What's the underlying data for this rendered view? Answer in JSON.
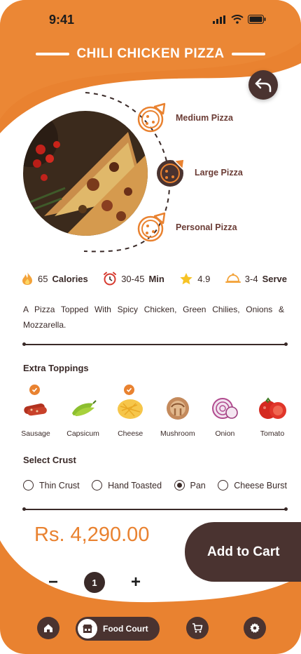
{
  "status_bar": {
    "time": "9:41"
  },
  "header": {
    "title": "CHILI CHICKEN PIZZA"
  },
  "sizes": [
    {
      "label": "Medium Pizza",
      "selected": false
    },
    {
      "label": "Large Pizza",
      "selected": true
    },
    {
      "label": "Personal Pizza",
      "selected": false
    }
  ],
  "stats": {
    "calories_value": "65",
    "calories_label": "Calories",
    "time_value": "30-45",
    "time_label": "Min",
    "rating": "4.9",
    "serve_value": "3-4",
    "serve_label": "Serve"
  },
  "description": "A Pizza Topped With Spicy Chicken, Green Chilies, Onions & Mozzarella.",
  "toppings": {
    "title": "Extra Toppings",
    "items": [
      {
        "name": "Sausage",
        "selected": true
      },
      {
        "name": "Capsicum",
        "selected": false
      },
      {
        "name": "Cheese",
        "selected": true
      },
      {
        "name": "Mushroom",
        "selected": false
      },
      {
        "name": "Onion",
        "selected": false
      },
      {
        "name": "Tomato",
        "selected": false
      }
    ]
  },
  "crust": {
    "title": "Select Crust",
    "options": [
      "Thin Crust",
      "Hand Toasted",
      "Pan",
      "Cheese Burst"
    ],
    "selected": "Pan"
  },
  "price": "Rs. 4,290.00",
  "add_to_cart_label": "Add to Cart",
  "quantity": {
    "minus": "−",
    "value": "1",
    "plus": "+"
  },
  "nav": {
    "active_label": "Food Court",
    "icons": [
      "home-icon",
      "food-court-icon",
      "cart-icon",
      "settings-icon"
    ]
  },
  "colors": {
    "accent": "#E98230",
    "dark": "#4A3330",
    "text": "#3A2A28"
  }
}
